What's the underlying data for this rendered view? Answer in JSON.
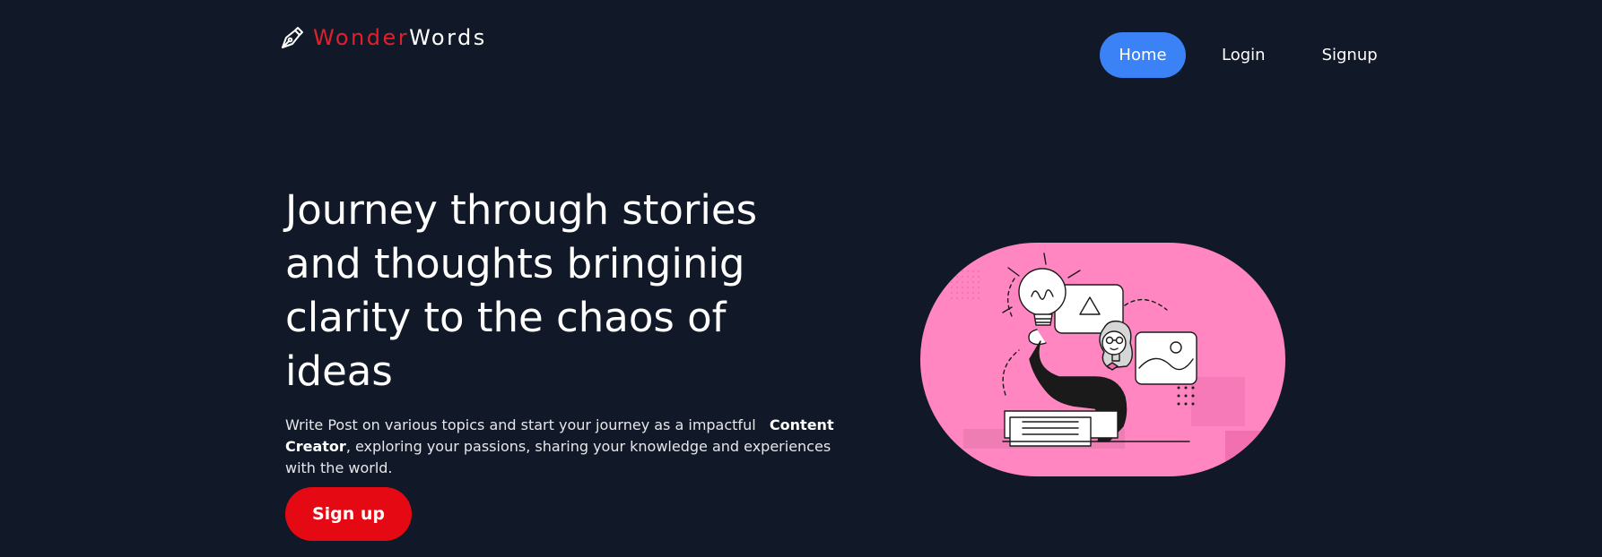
{
  "header": {
    "brand_accent": "Wonder",
    "brand_rest": "Words",
    "logo_icon": "pen-nib-icon",
    "nav": {
      "home": "Home",
      "login": "Login",
      "signup": "Signup"
    }
  },
  "hero": {
    "title": "Journey through stories and thoughts bringinig clarity to the chaos of ideas",
    "description_before": "Write Post on various topics and start your journey as a impactful",
    "description_highlight": "Content Creator",
    "description_after": ", exploring your passions, sharing your knowledge and experiences with the world.",
    "cta_label": "Sign up",
    "illustration_icon": "idea-woman-illustration"
  },
  "colors": {
    "background": "#111827",
    "brand_accent": "#e0202c",
    "nav_active": "#3b82f6",
    "cta": "#e50914",
    "illustration_bg": "#ff86c0"
  }
}
